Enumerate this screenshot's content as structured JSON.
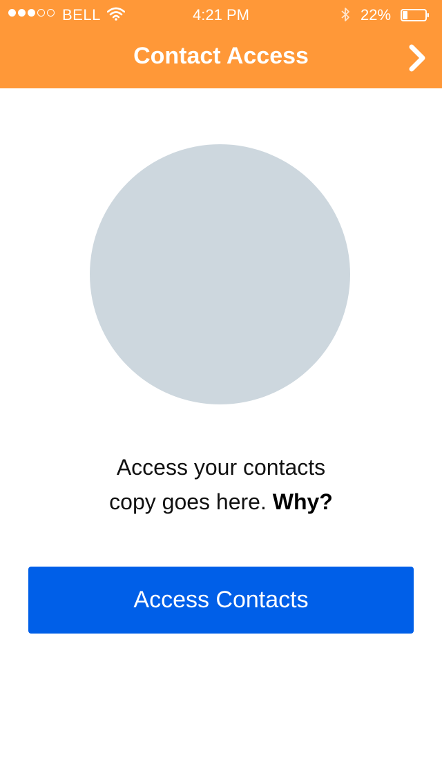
{
  "status_bar": {
    "signal_bars_filled": 3,
    "signal_bars_total": 5,
    "carrier": "BELL",
    "wifi_icon": "wifi-icon",
    "time": "4:21 PM",
    "bluetooth_icon": "bluetooth-icon",
    "battery_percent": "22%",
    "battery_level": 0.22
  },
  "nav": {
    "title": "Contact Access",
    "next_icon": "chevron-right-icon"
  },
  "content": {
    "copy_line1": "Access your contacts",
    "copy_line2": "copy goes here.",
    "why_link": "Why?",
    "button_label": "Access Contacts"
  },
  "colors": {
    "header": "#ff9838",
    "primary": "#005fe8",
    "placeholder": "#cdd7de"
  }
}
